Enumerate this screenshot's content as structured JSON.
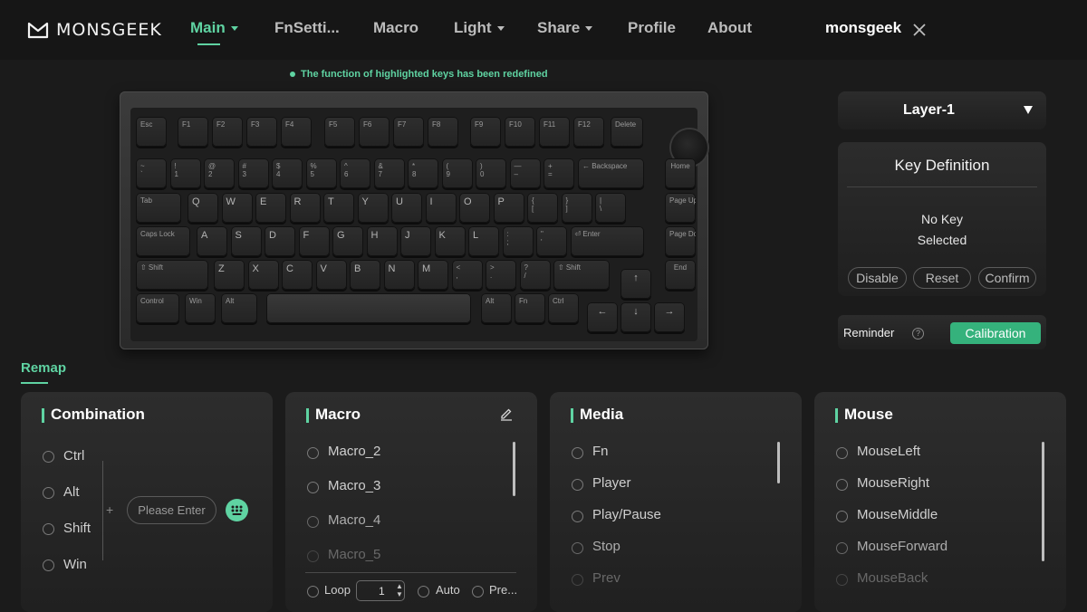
{
  "nav": {
    "brand": "MONSGEEK",
    "items": [
      {
        "label": "Main",
        "dropdown": true,
        "active": true
      },
      {
        "label": "FnSetti...",
        "dropdown": false,
        "active": false
      },
      {
        "label": "Macro",
        "dropdown": false,
        "active": false
      },
      {
        "label": "Light",
        "dropdown": true,
        "active": false
      },
      {
        "label": "Share",
        "dropdown": true,
        "active": false
      },
      {
        "label": "Profile",
        "dropdown": false,
        "active": false
      },
      {
        "label": "About",
        "dropdown": false,
        "active": false
      }
    ],
    "device_name": "monsgeek"
  },
  "notice": "The function of highlighted keys has been redefined",
  "keyboard": {
    "fn_row": [
      "Esc",
      "F1",
      "F2",
      "F3",
      "F4",
      "F5",
      "F6",
      "F7",
      "F8",
      "F9",
      "F10",
      "F11",
      "F12",
      "Delete"
    ],
    "num_row": [
      {
        "top": "~",
        "bottom": "`"
      },
      {
        "top": "!",
        "bottom": "1"
      },
      {
        "top": "@",
        "bottom": "2"
      },
      {
        "top": "#",
        "bottom": "3"
      },
      {
        "top": "$",
        "bottom": "4"
      },
      {
        "top": "%",
        "bottom": "5"
      },
      {
        "top": "^",
        "bottom": "6"
      },
      {
        "top": "&",
        "bottom": "7"
      },
      {
        "top": "*",
        "bottom": "8"
      },
      {
        "top": "(",
        "bottom": "9"
      },
      {
        "top": ")",
        "bottom": "0"
      },
      {
        "top": "—",
        "bottom": "–"
      },
      {
        "top": "+",
        "bottom": "="
      }
    ],
    "backspace": "← Backspace",
    "tab": "Tab",
    "row_q": [
      "Q",
      "W",
      "E",
      "R",
      "T",
      "Y",
      "U",
      "I",
      "O",
      "P"
    ],
    "row_q_sym": [
      {
        "top": "{",
        "bottom": "["
      },
      {
        "top": "}",
        "bottom": "]"
      },
      {
        "top": "|",
        "bottom": "\\"
      }
    ],
    "caps": "Caps Lock",
    "row_a": [
      "A",
      "S",
      "D",
      "F",
      "G",
      "H",
      "J",
      "K",
      "L"
    ],
    "row_a_sym": [
      {
        "top": ":",
        "bottom": ";"
      },
      {
        "top": "\"",
        "bottom": "'"
      }
    ],
    "enter": "Enter",
    "shift": "Shift",
    "row_z": [
      "Z",
      "X",
      "C",
      "V",
      "B",
      "N",
      "M"
    ],
    "row_z_sym": [
      {
        "top": "<",
        "bottom": ","
      },
      {
        "top": ">",
        "bottom": "."
      },
      {
        "top": "?",
        "bottom": "/"
      }
    ],
    "bottom_row": [
      "Control",
      "Win",
      "Alt",
      "Alt",
      "Fn",
      "Ctrl"
    ],
    "nav_keys": [
      "Home",
      "Page Up",
      "Page Down",
      "End"
    ],
    "arrows": {
      "up": "↑",
      "left": "←",
      "down": "↓",
      "right": "→"
    }
  },
  "layer": {
    "selected": "Layer-1"
  },
  "key_definition": {
    "title": "Key Definition",
    "message_line1": "No Key",
    "message_line2": "Selected",
    "buttons": [
      "Disable",
      "Reset",
      "Confirm"
    ]
  },
  "reminder": {
    "label": "Reminder",
    "help": "?",
    "calibration_label": "Calibration"
  },
  "remap_title": "Remap",
  "combination": {
    "title": "Combination",
    "modifiers": [
      "Ctrl",
      "Alt",
      "Shift",
      "Win"
    ],
    "plus": "+",
    "placeholder": "Please Enter"
  },
  "macro": {
    "title": "Macro",
    "items": [
      "Macro_2",
      "Macro_3",
      "Macro_4",
      "Macro_5"
    ],
    "loop_label": "Loop",
    "loop_value": "1",
    "auto_label": "Auto",
    "pre_label": "Pre..."
  },
  "media": {
    "title": "Media",
    "items": [
      "Fn",
      "Player",
      "Play/Pause",
      "Stop",
      "Prev"
    ]
  },
  "mouse": {
    "title": "Mouse",
    "items": [
      "MouseLeft",
      "MouseRight",
      "MouseMiddle",
      "MouseForward",
      "MouseBack"
    ]
  },
  "colors": {
    "accent": "#5fd3a2",
    "button_green": "#35b27c",
    "background": "#1b1b1b"
  }
}
